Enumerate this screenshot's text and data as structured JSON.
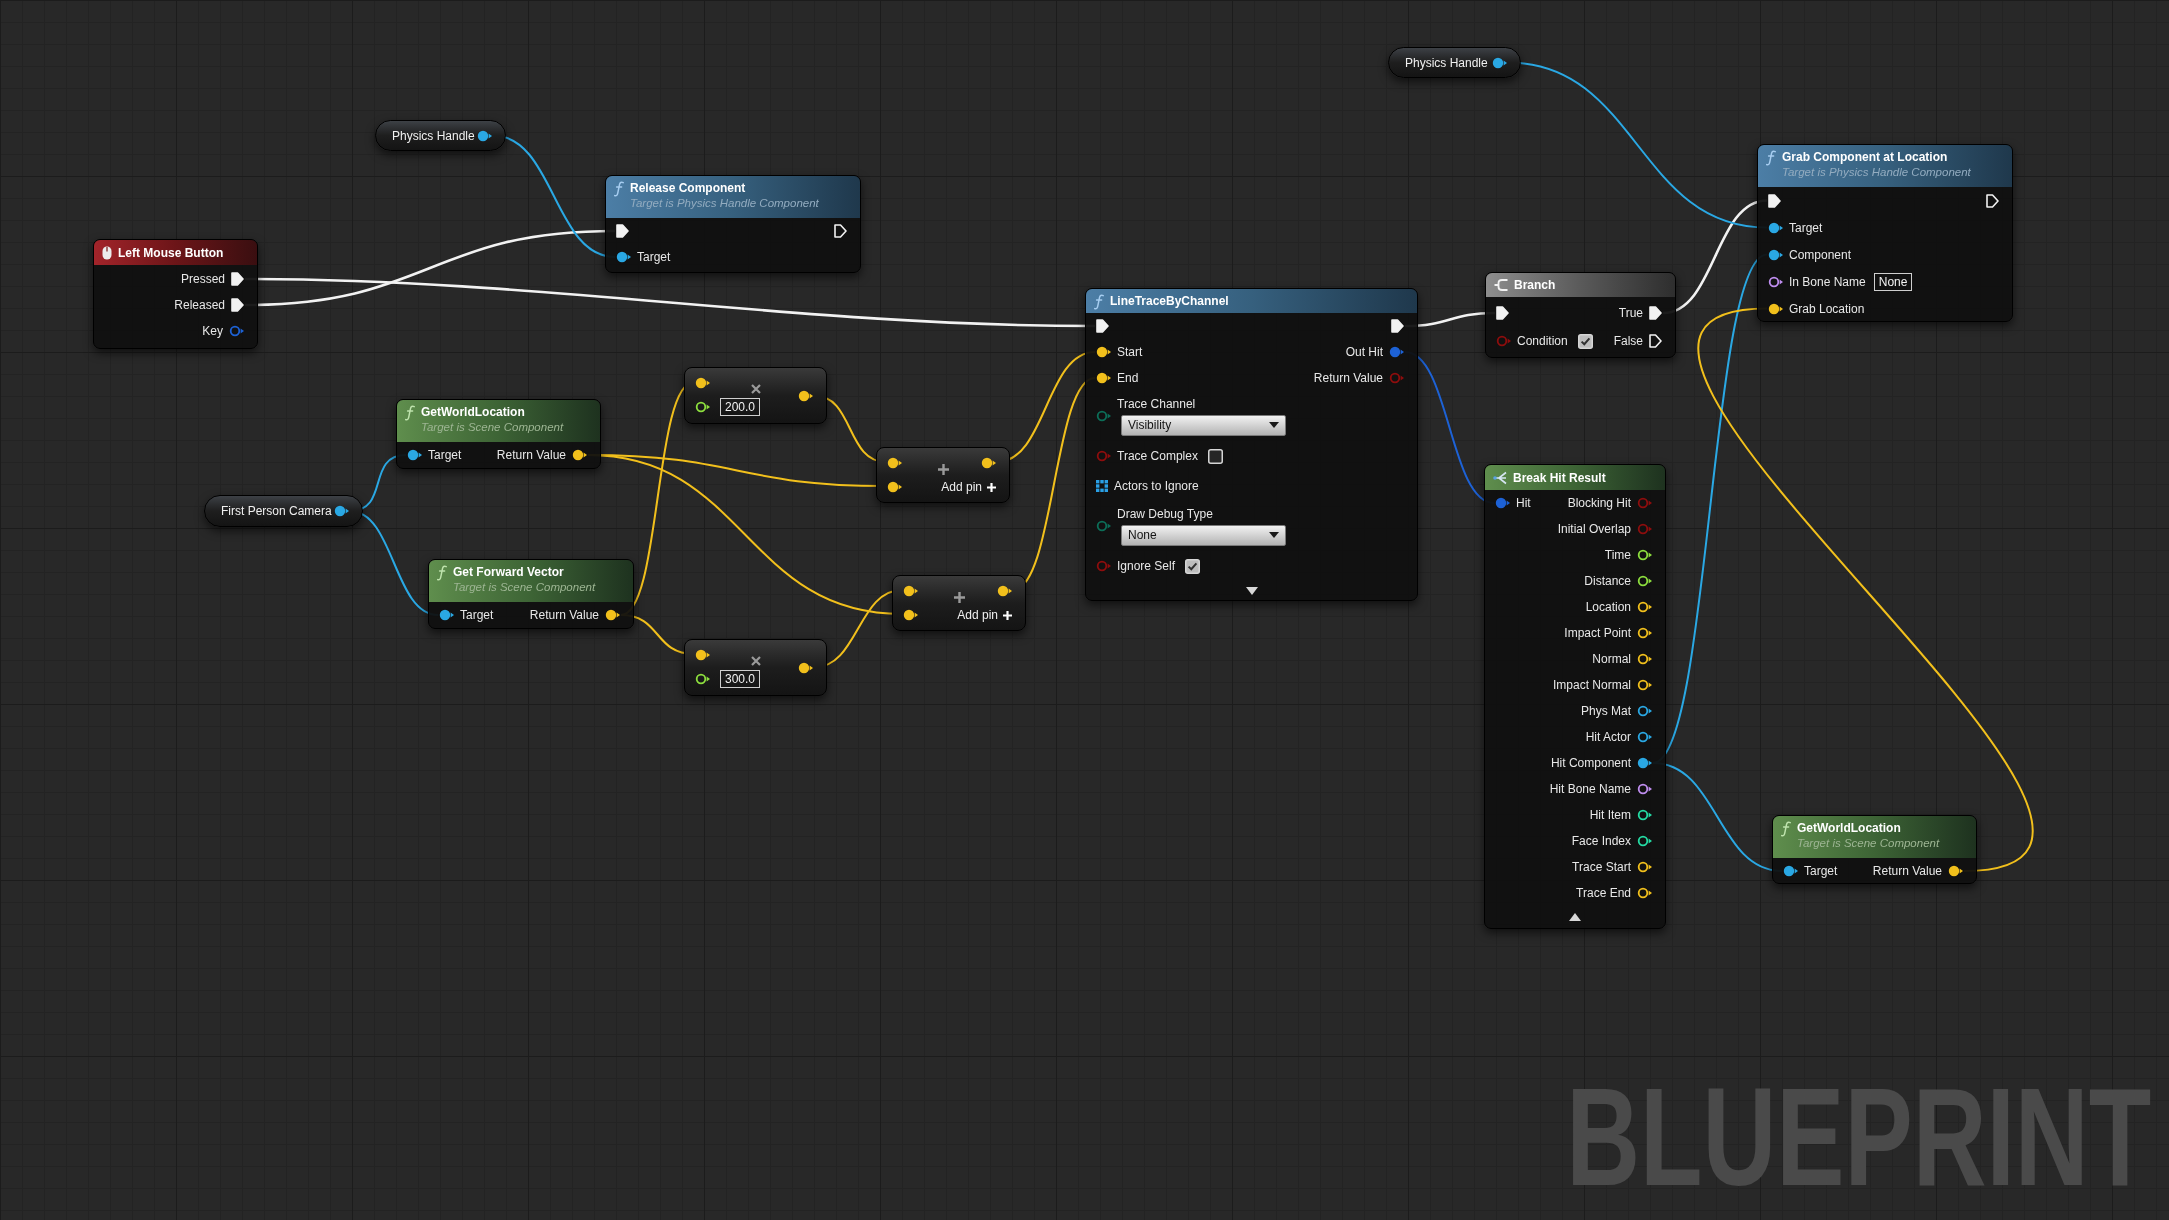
{
  "graph": {
    "nodes": [
      {
        "kind": "variable",
        "title": "Physics Handle",
        "output": {
          "kind": "object",
          "connected": true
        }
      },
      {
        "kind": "function",
        "title": "Release Component",
        "subtitle": "Target is Physics Handle Component",
        "rows": [
          {
            "left": {
              "kind": "exec",
              "connected": true
            },
            "right": {
              "kind": "exec",
              "connected": false
            }
          },
          {
            "left": {
              "label": "Target",
              "kind": "object",
              "connected": true
            }
          }
        ]
      },
      {
        "kind": "event",
        "title": "Left Mouse Button",
        "rows": [
          {
            "right": {
              "label": "Pressed",
              "kind": "exec",
              "connected": true
            }
          },
          {
            "right": {
              "label": "Released",
              "kind": "exec",
              "connected": true
            }
          },
          {
            "right": {
              "label": "Key",
              "kind": "struct",
              "connected": false
            }
          }
        ]
      },
      {
        "kind": "pure",
        "title": "GetWorldLocation",
        "subtitle": "Target is Scene Component",
        "rows": [
          {
            "left": {
              "label": "Target",
              "kind": "object",
              "connected": true
            },
            "right": {
              "label": "Return Value",
              "kind": "vector",
              "connected": true
            }
          }
        ]
      },
      {
        "kind": "variable",
        "title": "First Person Camera",
        "output": {
          "kind": "object",
          "connected": true
        }
      },
      {
        "kind": "pure",
        "title": "Get Forward Vector",
        "subtitle": "Target is Scene Component",
        "rows": [
          {
            "left": {
              "label": "Target",
              "kind": "object",
              "connected": true
            },
            "right": {
              "label": "Return Value",
              "kind": "vector",
              "connected": true
            }
          }
        ]
      },
      {
        "kind": "multiply",
        "inputs": [
          {
            "kind": "vector",
            "connected": true
          },
          {
            "kind": "float",
            "connected": false,
            "value": "200.0"
          }
        ],
        "output": {
          "kind": "vector",
          "connected": true
        }
      },
      {
        "kind": "add",
        "inputs": [
          {
            "kind": "vector",
            "connected": true
          },
          {
            "kind": "vector",
            "connected": true
          }
        ],
        "output": {
          "kind": "vector",
          "connected": true
        },
        "add_pin": "Add pin"
      },
      {
        "kind": "add",
        "inputs": [
          {
            "kind": "vector",
            "connected": true
          },
          {
            "kind": "vector",
            "connected": true
          }
        ],
        "output": {
          "kind": "vector",
          "connected": true
        },
        "add_pin": "Add pin"
      },
      {
        "kind": "multiply",
        "inputs": [
          {
            "kind": "vector",
            "connected": true
          },
          {
            "kind": "float",
            "connected": false,
            "value": "300.0"
          }
        ],
        "output": {
          "kind": "vector",
          "connected": true
        }
      },
      {
        "kind": "function",
        "title": "LineTraceByChannel",
        "expanded": false,
        "rows": [
          {
            "left": {
              "kind": "exec",
              "connected": true
            },
            "right": {
              "kind": "exec",
              "connected": true
            }
          },
          {
            "left": {
              "label": "Start",
              "kind": "vector",
              "connected": true
            },
            "right": {
              "label": "Out Hit",
              "kind": "struct",
              "connected": true
            }
          },
          {
            "left": {
              "label": "End",
              "kind": "vector",
              "connected": true
            },
            "right": {
              "label": "Return Value",
              "kind": "bool",
              "connected": false
            }
          },
          {
            "left": {
              "label": "Trace Channel",
              "kind": "enum",
              "connected": false,
              "dropdown": "Visibility"
            }
          },
          {
            "left": {
              "label": "Trace Complex",
              "kind": "bool",
              "connected": false,
              "checked": false
            }
          },
          {
            "left": {
              "label": "Actors to Ignore",
              "kind": "array",
              "connected": false
            }
          },
          {
            "left": {
              "label": "Draw Debug Type",
              "kind": "enum",
              "connected": false,
              "dropdown": "None"
            }
          },
          {
            "left": {
              "label": "Ignore Self",
              "kind": "bool",
              "connected": false,
              "checked": true
            }
          }
        ]
      },
      {
        "kind": "variable",
        "title": "Physics Handle",
        "output": {
          "kind": "object",
          "connected": true
        }
      },
      {
        "kind": "function",
        "title": "Grab Component at Location",
        "subtitle": "Target is Physics Handle Component",
        "rows": [
          {
            "left": {
              "kind": "exec",
              "connected": true
            },
            "right": {
              "kind": "exec",
              "connected": false
            }
          },
          {
            "left": {
              "label": "Target",
              "kind": "object",
              "connected": true
            }
          },
          {
            "left": {
              "label": "Component",
              "kind": "object",
              "connected": true
            }
          },
          {
            "left": {
              "label": "In Bone Name",
              "kind": "name",
              "connected": false,
              "value": "None"
            }
          },
          {
            "left": {
              "label": "Grab Location",
              "kind": "vector",
              "connected": true
            }
          }
        ]
      },
      {
        "kind": "branch",
        "title": "Branch",
        "rows": [
          {
            "left": {
              "kind": "exec",
              "connected": true
            },
            "right": {
              "label": "True",
              "kind": "exec",
              "connected": true
            }
          },
          {
            "left": {
              "label": "Condition",
              "kind": "bool",
              "connected": false,
              "checked": true
            },
            "right": {
              "label": "False",
              "kind": "exec",
              "connected": false
            }
          }
        ]
      },
      {
        "kind": "break",
        "title": "Break Hit Result",
        "expanded": true,
        "rows": [
          {
            "left": {
              "label": "Hit",
              "kind": "struct",
              "connected": true
            },
            "right": {
              "label": "Blocking Hit",
              "kind": "bool",
              "connected": false
            }
          },
          {
            "right": {
              "label": "Initial Overlap",
              "kind": "bool",
              "connected": false
            }
          },
          {
            "right": {
              "label": "Time",
              "kind": "float",
              "connected": false
            }
          },
          {
            "right": {
              "label": "Distance",
              "kind": "float",
              "connected": false
            }
          },
          {
            "right": {
              "label": "Location",
              "kind": "vector",
              "connected": false
            }
          },
          {
            "right": {
              "label": "Impact Point",
              "kind": "vector",
              "connected": false
            }
          },
          {
            "right": {
              "label": "Normal",
              "kind": "vector",
              "connected": false
            }
          },
          {
            "right": {
              "label": "Impact Normal",
              "kind": "vector",
              "connected": false
            }
          },
          {
            "right": {
              "label": "Phys Mat",
              "kind": "object",
              "connected": false
            }
          },
          {
            "right": {
              "label": "Hit Actor",
              "kind": "object",
              "connected": false
            }
          },
          {
            "right": {
              "label": "Hit Component",
              "kind": "object",
              "connected": true
            }
          },
          {
            "right": {
              "label": "Hit Bone Name",
              "kind": "name",
              "connected": false
            }
          },
          {
            "right": {
              "label": "Hit Item",
              "kind": "int",
              "connected": false
            }
          },
          {
            "right": {
              "label": "Face Index",
              "kind": "int",
              "connected": false
            }
          },
          {
            "right": {
              "label": "Trace Start",
              "kind": "vector",
              "connected": false
            }
          },
          {
            "right": {
              "label": "Trace End",
              "kind": "vector",
              "connected": false
            }
          }
        ]
      },
      {
        "kind": "pure",
        "title": "GetWorldLocation",
        "subtitle": "Target is Scene Component",
        "rows": [
          {
            "left": {
              "label": "Target",
              "kind": "object",
              "connected": true
            },
            "right": {
              "label": "Return Value",
              "kind": "vector",
              "connected": true
            }
          }
        ]
      }
    ],
    "corner_label": "BLUEPRINT"
  }
}
